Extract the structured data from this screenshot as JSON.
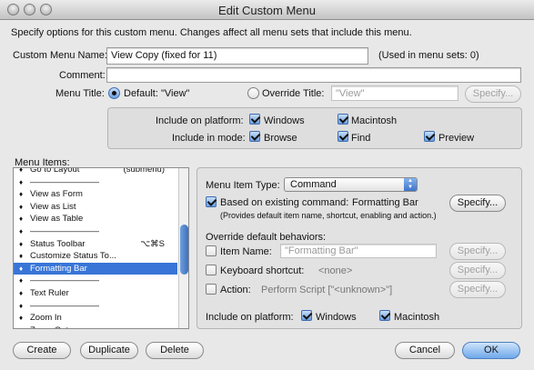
{
  "window": {
    "title": "Edit Custom Menu"
  },
  "instructions": "Specify options for this custom menu.  Changes affect all menu sets that include this menu.",
  "menu_name": {
    "label": "Custom Menu Name:",
    "value": "View Copy (fixed for 11)",
    "usage": "(Used in menu sets: 0)"
  },
  "comment": {
    "label": "Comment:",
    "value": ""
  },
  "menu_title": {
    "label": "Menu Title:",
    "default_label": "Default: \"View\"",
    "override_label": "Override Title:",
    "override_value": "\"View\"",
    "specify": "Specify..."
  },
  "platform": {
    "label": "Include on platform:",
    "windows": "Windows",
    "mac": "Macintosh"
  },
  "mode": {
    "label": "Include in mode:",
    "browse": "Browse",
    "find": "Find",
    "preview": "Preview"
  },
  "menu_items": {
    "label": "Menu Items:",
    "items": [
      {
        "text": "Go to Layout",
        "shortcut": "(submenu)"
      },
      {
        "text": "————————",
        "shortcut": ""
      },
      {
        "text": "View as Form",
        "shortcut": ""
      },
      {
        "text": "View as List",
        "shortcut": ""
      },
      {
        "text": "View as Table",
        "shortcut": ""
      },
      {
        "text": "————————",
        "shortcut": ""
      },
      {
        "text": "Status Toolbar",
        "shortcut": "⌥⌘S"
      },
      {
        "text": "Customize Status To...",
        "shortcut": ""
      },
      {
        "text": "Formatting Bar",
        "shortcut": ""
      },
      {
        "text": "————————",
        "shortcut": ""
      },
      {
        "text": "Text Ruler",
        "shortcut": ""
      },
      {
        "text": "————————",
        "shortcut": ""
      },
      {
        "text": "Zoom In",
        "shortcut": ""
      },
      {
        "text": "Zoom Out",
        "shortcut": ""
      }
    ],
    "selected_index": 8
  },
  "item_panel": {
    "type_label": "Menu Item Type:",
    "type_value": "Command",
    "based_on_label": "Based on existing command:",
    "based_on_value": "Formatting Bar",
    "specify": "Specify...",
    "based_on_note": "(Provides default item name, shortcut, enabling and action.)",
    "override_label": "Override default behaviors:",
    "item_name_label": "Item Name:",
    "item_name_value": "\"Formatting Bar\"",
    "shortcut_label": "Keyboard shortcut:",
    "shortcut_value": "<none>",
    "action_label": "Action:",
    "action_value": "Perform Script [\"<unknown>\"]",
    "platform_label": "Include on platform:",
    "windows": "Windows",
    "mac": "Macintosh"
  },
  "footer": {
    "create": "Create",
    "duplicate": "Duplicate",
    "delete": "Delete",
    "cancel": "Cancel",
    "ok": "OK"
  }
}
